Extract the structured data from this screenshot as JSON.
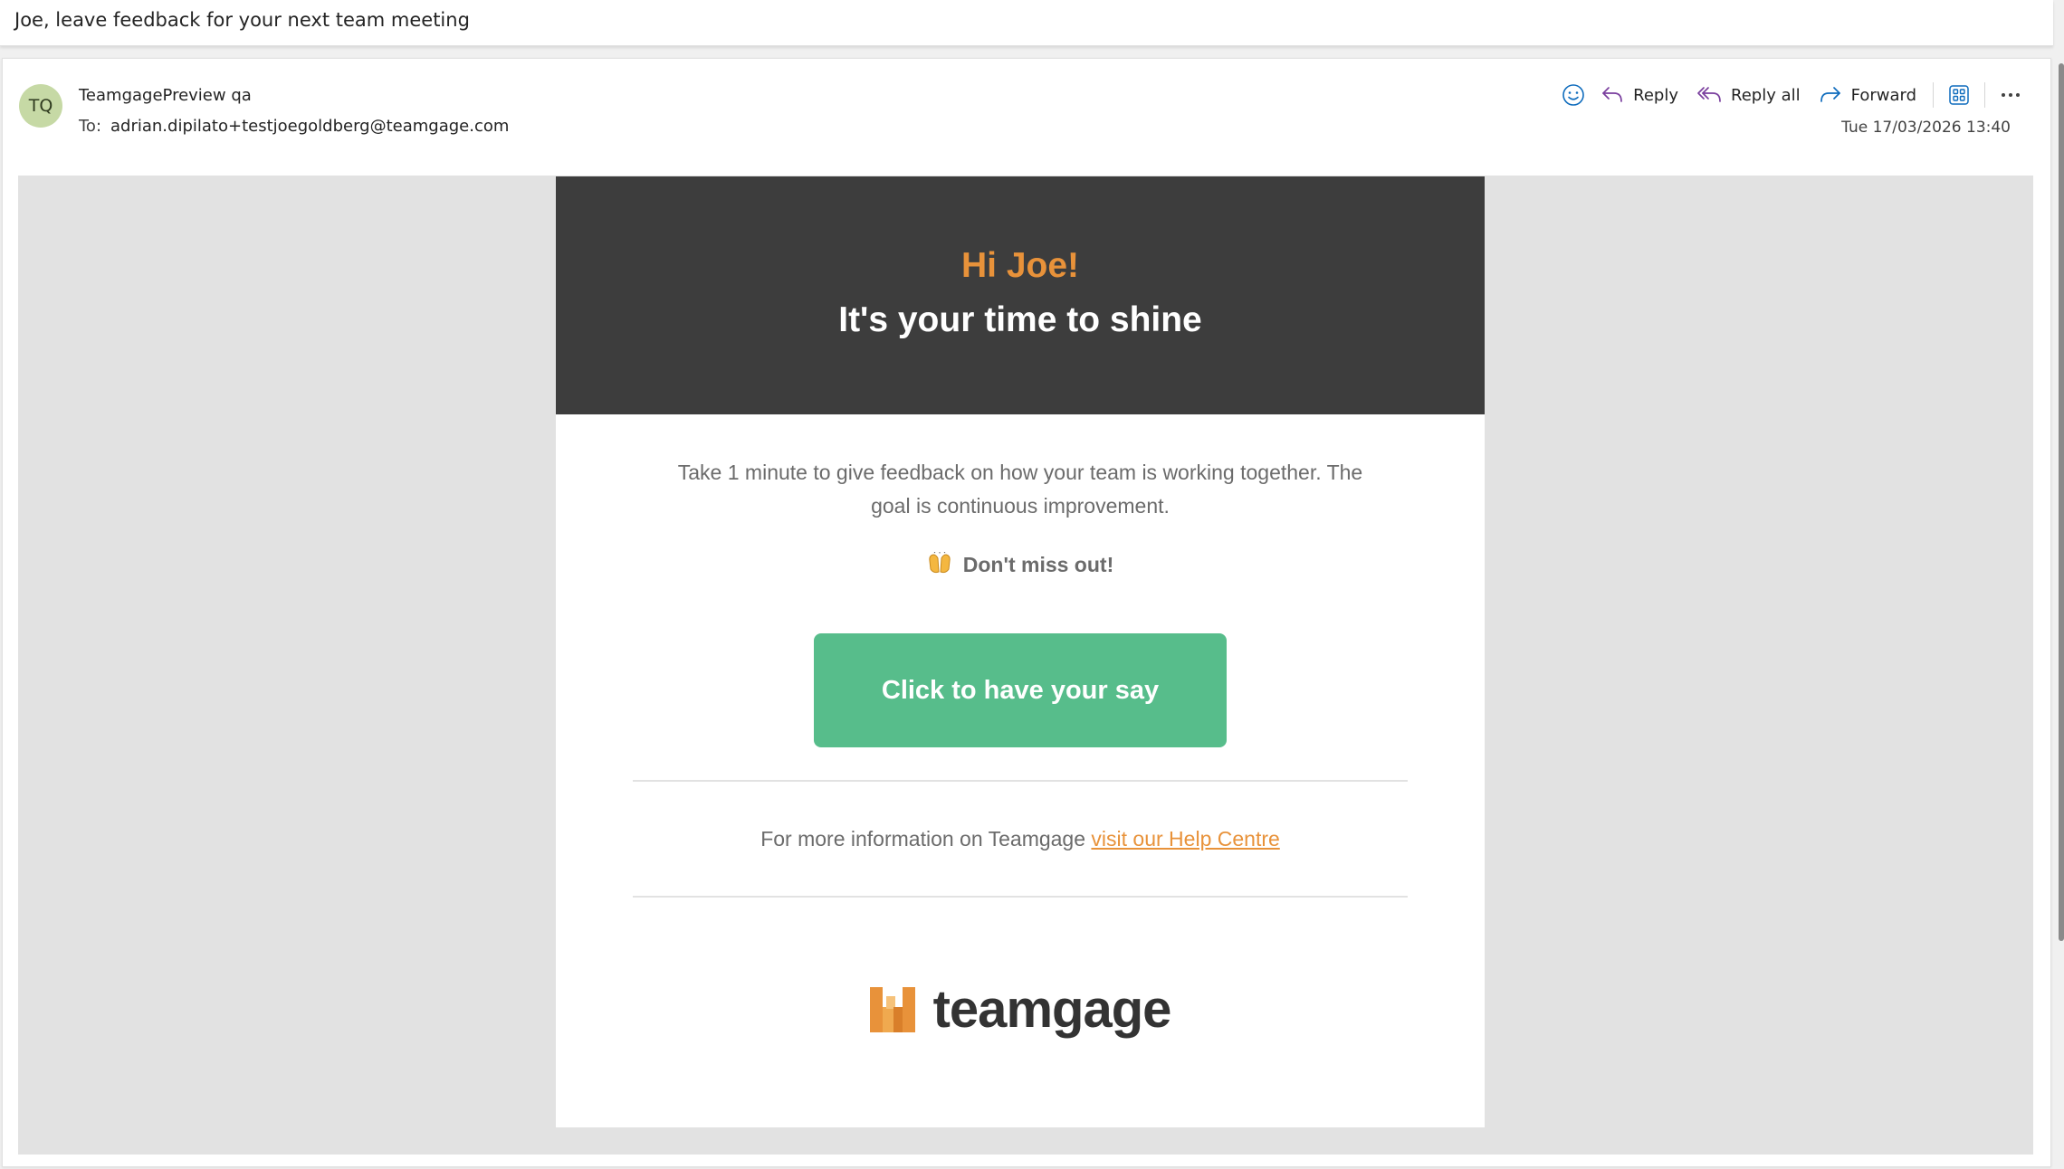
{
  "subject": "Joe, leave feedback for your next team meeting",
  "message": {
    "avatar_initials": "TQ",
    "sender_name": "TeamgagePreview qa",
    "to_label": "To:",
    "to_address": "adrian.dipilato+testjoegoldberg@teamgage.com",
    "date": "Tue 17/03/2026 13:40",
    "actions": {
      "reply": "Reply",
      "reply_all": "Reply all",
      "forward": "Forward"
    }
  },
  "email": {
    "greeting": "Hi Joe!",
    "headline": "It's your time to shine",
    "intro": "Take 1 minute to give feedback on how your team is working together. The goal is continuous improvement.",
    "dont_miss": "Don't miss out!",
    "cta": "Click to have your say",
    "more_info_prefix": "For more information on Teamgage ",
    "help_link": "visit our Help Centre",
    "logo_text": "teamgage"
  },
  "colors": {
    "accent_orange": "#e8923a",
    "cta_green": "#57bd8b",
    "hero_bg": "#3d3d3d",
    "icon_blue": "#0f6cbd",
    "icon_purple": "#7a3f9e"
  }
}
